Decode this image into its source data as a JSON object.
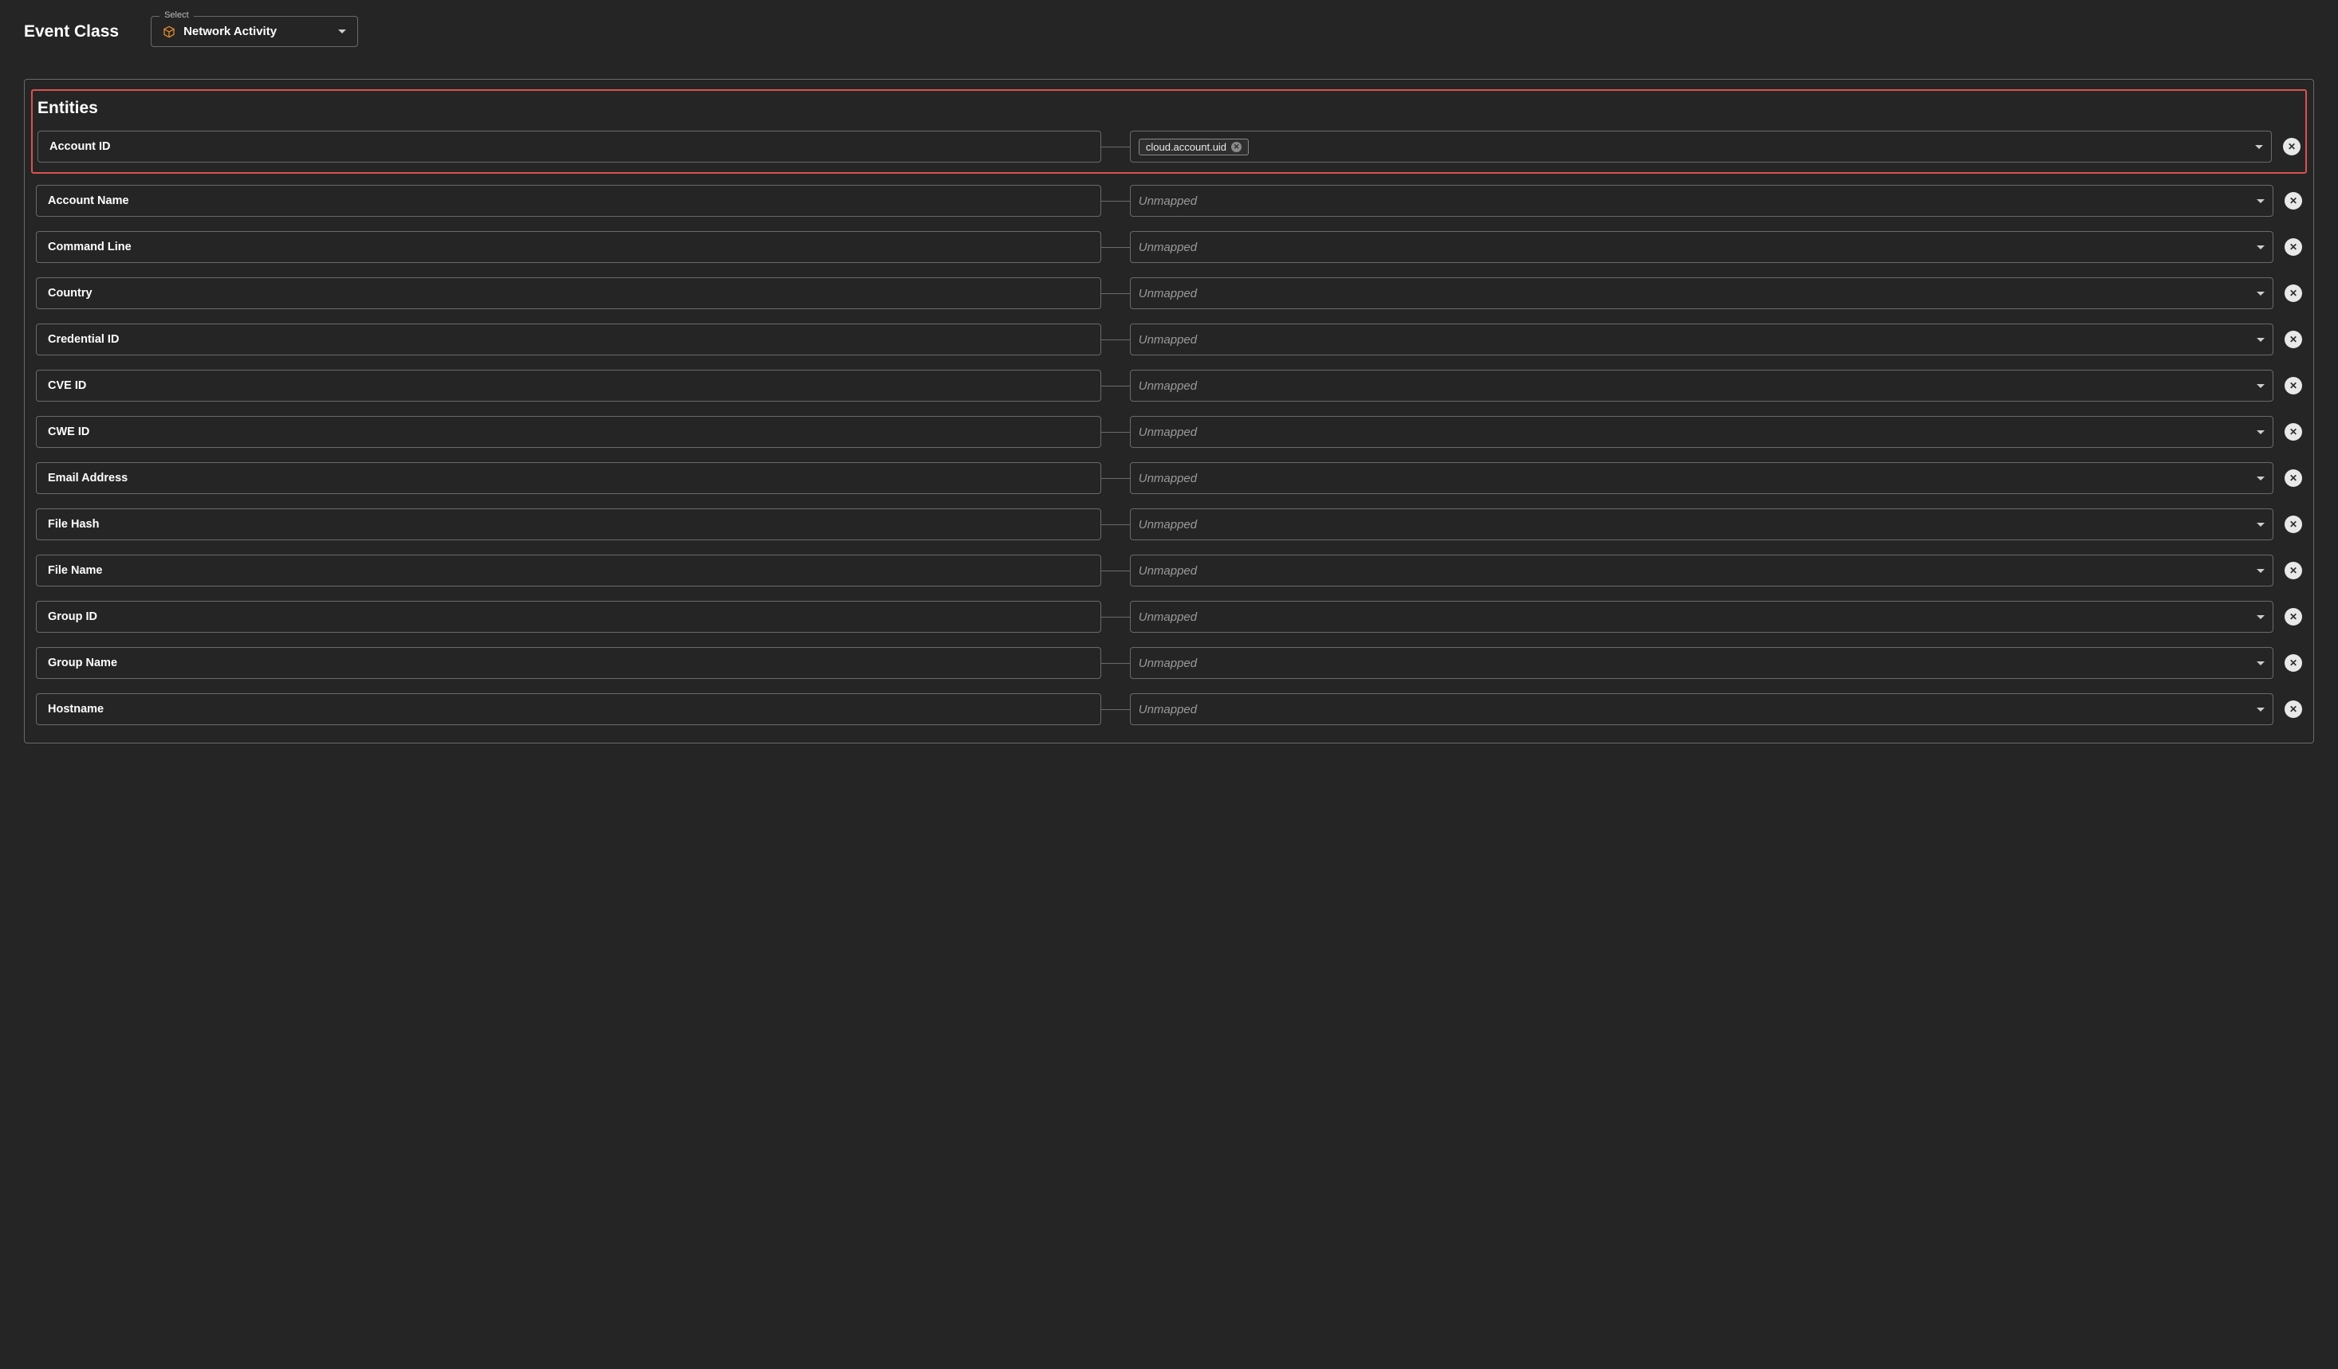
{
  "eventClass": {
    "title": "Event Class",
    "selectLabel": "Select",
    "value": "Network Activity"
  },
  "entities": {
    "heading": "Entities",
    "rows": [
      {
        "label": "Account ID",
        "mapped": true,
        "chips": [
          "cloud.account.uid"
        ],
        "highlighted": true
      },
      {
        "label": "Account Name",
        "mapped": false,
        "placeholder": "Unmapped"
      },
      {
        "label": "Command Line",
        "mapped": false,
        "placeholder": "Unmapped"
      },
      {
        "label": "Country",
        "mapped": false,
        "placeholder": "Unmapped"
      },
      {
        "label": "Credential ID",
        "mapped": false,
        "placeholder": "Unmapped"
      },
      {
        "label": "CVE ID",
        "mapped": false,
        "placeholder": "Unmapped"
      },
      {
        "label": "CWE ID",
        "mapped": false,
        "placeholder": "Unmapped"
      },
      {
        "label": "Email Address",
        "mapped": false,
        "placeholder": "Unmapped"
      },
      {
        "label": "File Hash",
        "mapped": false,
        "placeholder": "Unmapped"
      },
      {
        "label": "File Name",
        "mapped": false,
        "placeholder": "Unmapped"
      },
      {
        "label": "Group ID",
        "mapped": false,
        "placeholder": "Unmapped"
      },
      {
        "label": "Group Name",
        "mapped": false,
        "placeholder": "Unmapped"
      },
      {
        "label": "Hostname",
        "mapped": false,
        "placeholder": "Unmapped"
      }
    ]
  }
}
